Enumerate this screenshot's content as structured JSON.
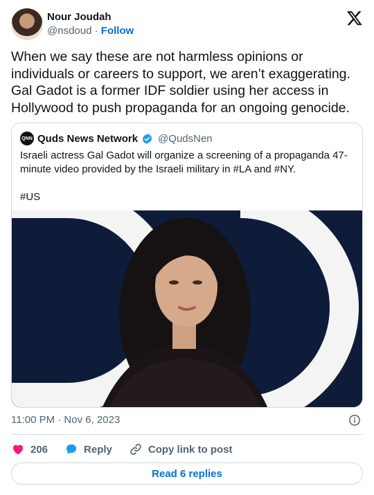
{
  "author": {
    "name": "Nour Joudah",
    "handle": "@nsdoud",
    "separator": "·",
    "follow_label": "Follow"
  },
  "tweet": {
    "text": "When we say these are not harmless opinions or individuals or careers to support, we aren’t exaggerating. Gal Gadot is a former IDF soldier using her access in Hollywood to push propaganda for an ongoing genocide."
  },
  "quoted": {
    "name": "Quds News Network",
    "handle": "@QudsNen",
    "avatar_text": "QNN",
    "text": "Israeli actress Gal Gadot will organize a screening of a propaganda 47-minute video provided by the Israeli military in #LA and #NY.\n\n#US",
    "verified_color": "#1d9bf0"
  },
  "meta": {
    "timestamp": "11:00 PM · Nov 6, 2023"
  },
  "actions": {
    "like_count": "206",
    "reply_label": "Reply",
    "copy_label": "Copy link to post"
  },
  "replies_button": "Read 6 replies",
  "colors": {
    "link": "#006fd6",
    "like": "#f91880",
    "reply": "#1d9bf0",
    "muted": "#536471",
    "border": "#cfd9de"
  }
}
